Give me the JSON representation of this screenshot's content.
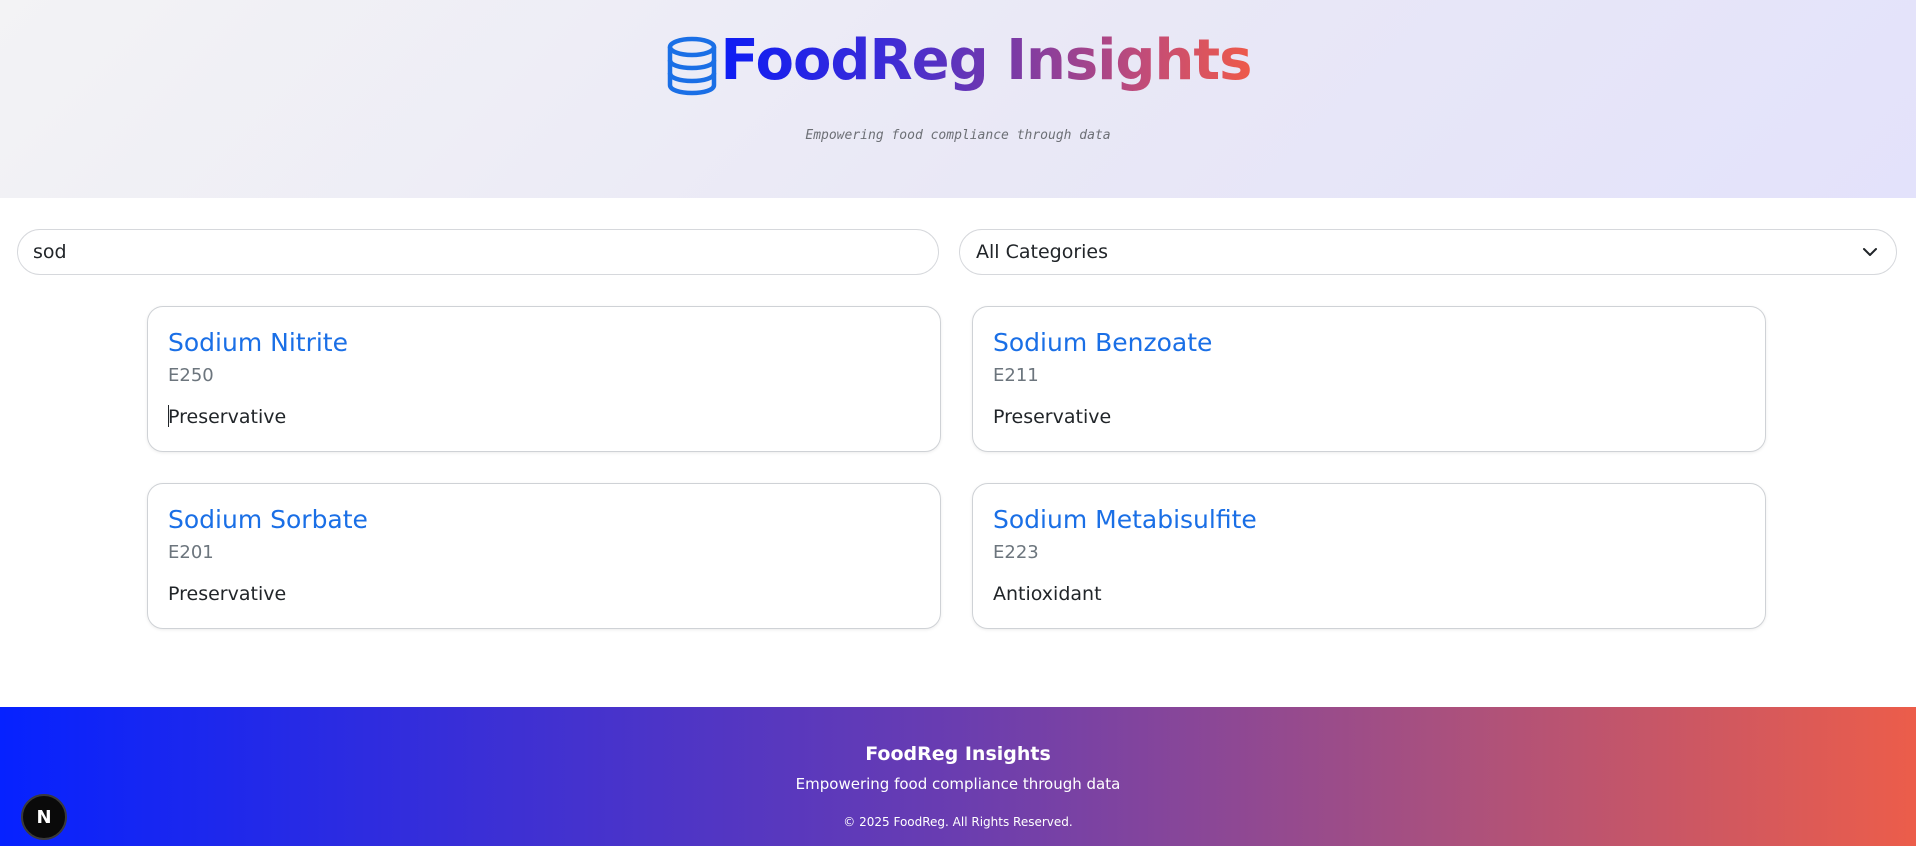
{
  "header": {
    "brand": "FoodReg Insights",
    "brand_icon": "database-icon",
    "tagline": "Empowering food compliance through data"
  },
  "filters": {
    "search_value": "sod",
    "category_selected": "All Categories"
  },
  "results": [
    {
      "name": "Sodium Nitrite",
      "code": "E250",
      "category": "Preservative"
    },
    {
      "name": "Sodium Benzoate",
      "code": "E211",
      "category": "Preservative"
    },
    {
      "name": "Sodium Sorbate",
      "code": "E201",
      "category": "Preservative"
    },
    {
      "name": "Sodium Metabisulfite",
      "code": "E223",
      "category": "Antioxidant"
    }
  ],
  "footer": {
    "title": "FoodReg Insights",
    "tagline": "Empowering food compliance through data",
    "copyright": "© 2025 FoodReg. All Rights Reserved."
  },
  "dev_badge": "N",
  "colors": {
    "accent": "#1a6fe6",
    "brand_start": "#0d1df4",
    "brand_end": "#ee5a4a"
  }
}
